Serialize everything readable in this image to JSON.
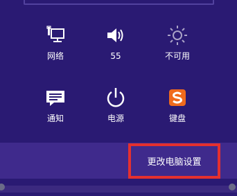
{
  "settings_charm": {
    "quick_settings": [
      {
        "label": "网络",
        "icon": "network-icon"
      },
      {
        "label": "55",
        "icon": "volume-icon"
      },
      {
        "label": "不可用",
        "icon": "brightness-icon"
      },
      {
        "label": "通知",
        "icon": "notifications-icon"
      },
      {
        "label": "电源",
        "icon": "power-icon"
      },
      {
        "label": "键盘",
        "icon": "keyboard-ime-icon"
      }
    ],
    "change_pc_settings": "更改电脑设置"
  },
  "colors": {
    "background": "#2a1a73",
    "footer_band": "#3f2a8c",
    "highlight_border": "#e5302f",
    "ime_logo": "#f06a1d"
  }
}
